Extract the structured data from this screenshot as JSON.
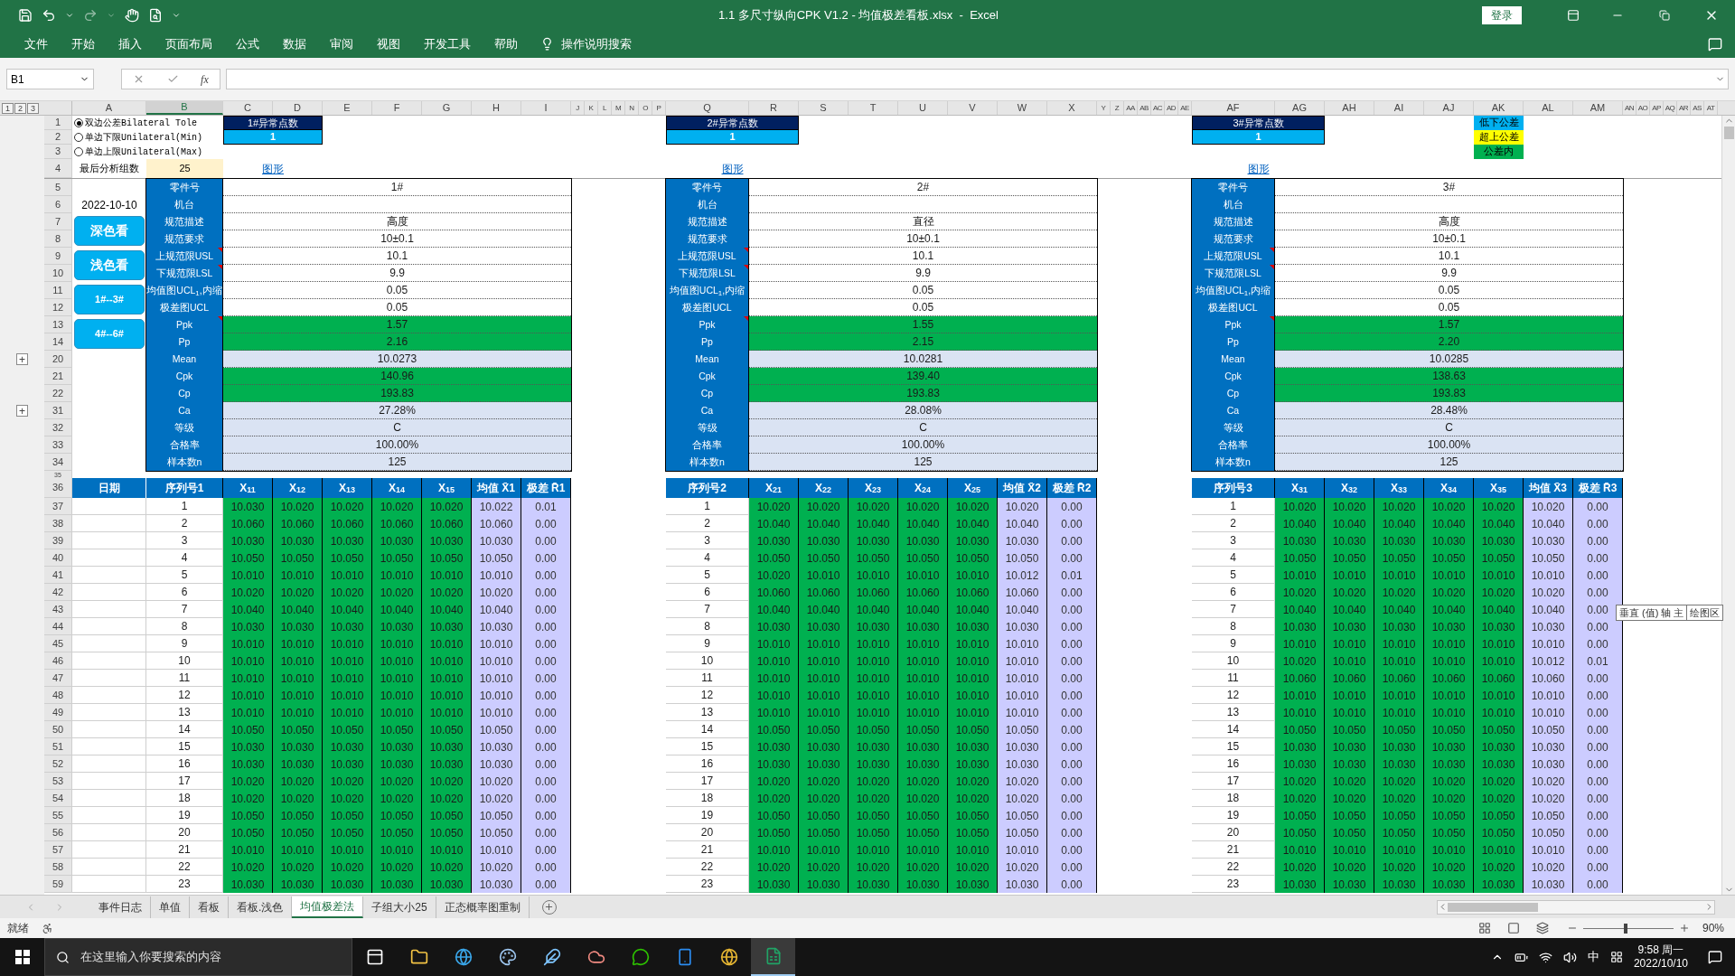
{
  "title_bar": {
    "title": "1.1 多尺寸纵向CPK V1.2 - 均值极差看板.xlsx  -  Excel",
    "sign_in": "登录"
  },
  "menu": [
    "文件",
    "开始",
    "插入",
    "页面布局",
    "公式",
    "数据",
    "审阅",
    "视图",
    "开发工具",
    "帮助"
  ],
  "tell_me": "操作说明搜索",
  "name_box": "B1",
  "fx": "fx",
  "outline_levels": [
    "1",
    "2",
    "3"
  ],
  "column_headers": [
    {
      "label": "A",
      "selected": false
    },
    {
      "label": "B",
      "selected": true
    },
    {
      "label": "C",
      "selected": false
    },
    {
      "label": "D",
      "selected": false
    },
    {
      "label": "E",
      "selected": false
    },
    {
      "label": "F",
      "selected": false
    },
    {
      "label": "G",
      "selected": false
    },
    {
      "label": "H",
      "selected": false
    },
    {
      "label": "I",
      "selected": false
    },
    {
      "label": "J",
      "selected": false
    },
    {
      "label": "K",
      "selected": false
    },
    {
      "label": "L",
      "selected": false
    },
    {
      "label": "M",
      "selected": false
    },
    {
      "label": "N",
      "selected": false
    },
    {
      "label": "O",
      "selected": false
    },
    {
      "label": "P",
      "selected": false
    },
    {
      "label": "Q",
      "selected": false
    },
    {
      "label": "R",
      "selected": false
    },
    {
      "label": "S",
      "selected": false
    },
    {
      "label": "T",
      "selected": false
    },
    {
      "label": "U",
      "selected": false
    },
    {
      "label": "V",
      "selected": false
    },
    {
      "label": "W",
      "selected": false
    },
    {
      "label": "X",
      "selected": false
    },
    {
      "label": "Y",
      "selected": false
    },
    {
      "label": "Z",
      "selected": false
    },
    {
      "label": "AA",
      "selected": false
    },
    {
      "label": "AB",
      "selected": false
    },
    {
      "label": "AC",
      "selected": false
    },
    {
      "label": "AD",
      "selected": false
    },
    {
      "label": "AE",
      "selected": false
    },
    {
      "label": "AF",
      "selected": false
    },
    {
      "label": "AG",
      "selected": false
    },
    {
      "label": "AH",
      "selected": false
    },
    {
      "label": "AI",
      "selected": false
    },
    {
      "label": "AJ",
      "selected": false
    },
    {
      "label": "AK",
      "selected": false
    },
    {
      "label": "AL",
      "selected": false
    },
    {
      "label": "AM",
      "selected": false
    },
    {
      "label": "AN",
      "selected": false
    },
    {
      "label": "AO",
      "selected": false
    },
    {
      "label": "AP",
      "selected": false
    },
    {
      "label": "AQ",
      "selected": false
    },
    {
      "label": "AR",
      "selected": false
    },
    {
      "label": "AS",
      "selected": false
    },
    {
      "label": "AT",
      "selected": false
    }
  ],
  "header_rows": [
    "1",
    "2",
    "3",
    "4"
  ],
  "options": [
    {
      "label": "双边公差Bilateral Tole",
      "selected": true
    },
    {
      "label": "单边下限Unilateral(Min)",
      "selected": false
    },
    {
      "label": "单边上限Unilateral(Max)",
      "selected": false
    }
  ],
  "group_count": {
    "label": "最后分析组数",
    "value": "25"
  },
  "legend": [
    {
      "label": "低下公差",
      "color": "#00b0f0"
    },
    {
      "label": "超上公差",
      "color": "#ffff00"
    },
    {
      "label": "公差内",
      "color": "#00b050"
    }
  ],
  "stat_rows": [
    {
      "label": "5"
    },
    {
      "label": "6"
    },
    {
      "label": "7"
    },
    {
      "label": "8"
    },
    {
      "label": "9"
    },
    {
      "label": "10"
    },
    {
      "label": "11"
    },
    {
      "label": "12"
    },
    {
      "label": "13"
    },
    {
      "label": "14"
    },
    {
      "label": "20",
      "expander": "+"
    },
    {
      "label": "21"
    },
    {
      "label": "22"
    },
    {
      "label": "31",
      "expander": "+"
    },
    {
      "label": "32"
    },
    {
      "label": "33"
    },
    {
      "label": "34"
    }
  ],
  "date": "2022-10-10",
  "view_buttons": [
    "深色看",
    "浅色看",
    "1#--3#",
    "4#--6#"
  ],
  "spacer_row": "35",
  "table_header_row": "36",
  "data_rows": [
    "37",
    "38",
    "39",
    "40",
    "41",
    "42",
    "43",
    "44",
    "45",
    "46",
    "47",
    "48",
    "49",
    "50",
    "51",
    "52",
    "53",
    "54",
    "55",
    "56",
    "57",
    "58",
    "59"
  ],
  "blocks": [
    {
      "abnormal": {
        "label": "1#异常点数",
        "value": "1"
      },
      "chart_link": "图形",
      "stats": [
        {
          "label": "零件号",
          "value": "1#",
          "kind": "input",
          "comment": false
        },
        {
          "label": "机台",
          "kind": "input",
          "comment": false
        },
        {
          "label": "规范描述",
          "value": "高度",
          "kind": "input",
          "comment": false
        },
        {
          "label": "规范要求",
          "value": "10±0.1",
          "kind": "input",
          "comment": false
        },
        {
          "label": "上规范限USL",
          "value": "10.1",
          "kind": "input",
          "comment": true
        },
        {
          "label": "下规范限LSL",
          "value": "9.9",
          "kind": "input",
          "comment": true
        },
        {
          "label": "均值图UCL$_{1}$,内缩",
          "value": "0.05",
          "kind": "input",
          "comment": false
        },
        {
          "label": "极差图UCL",
          "value": "0.05",
          "kind": "input",
          "comment": false
        },
        {
          "label": "Ppk",
          "value": "1.57",
          "kind": "pass",
          "comment": true
        },
        {
          "label": "Pp",
          "value": "2.16",
          "kind": "pass",
          "comment": false
        },
        {
          "label": "Mean",
          "value": "10.0273",
          "kind": "result",
          "comment": false
        },
        {
          "label": "Cpk",
          "value": "140.96",
          "kind": "pass",
          "comment": false
        },
        {
          "label": "Cp",
          "value": "193.83",
          "kind": "pass",
          "comment": false
        },
        {
          "label": "Ca",
          "value": "27.28%",
          "kind": "result",
          "comment": false
        },
        {
          "label": "等级",
          "value": "C",
          "kind": "result",
          "comment": false
        },
        {
          "label": "合格率",
          "value": "100.00%",
          "kind": "result",
          "comment": false
        },
        {
          "label": "样本数n",
          "value": "125",
          "kind": "result",
          "comment": false
        }
      ],
      "date_header": "日期",
      "columns": [
        {
          "label": "序列号1",
          "kind": "index"
        },
        {
          "label": "X$_{11}$",
          "kind": "measure"
        },
        {
          "label": "X$_{12}$",
          "kind": "measure"
        },
        {
          "label": "X$_{13}$",
          "kind": "measure"
        },
        {
          "label": "X$_{14}$",
          "kind": "measure"
        },
        {
          "label": "X$_{15}$",
          "kind": "measure"
        },
        {
          "label": "均值 X̄1",
          "kind": "summary"
        },
        {
          "label": "极差 R̄1",
          "kind": "summary"
        }
      ],
      "rows": [
        [
          "1",
          "10.030",
          "10.020",
          "10.020",
          "10.020",
          "10.020",
          "10.022",
          "0.01"
        ],
        [
          "2",
          "10.060",
          "10.060",
          "10.060",
          "10.060",
          "10.060",
          "10.060",
          "0.00"
        ],
        [
          "3",
          "10.030",
          "10.030",
          "10.030",
          "10.030",
          "10.030",
          "10.030",
          "0.00"
        ],
        [
          "4",
          "10.050",
          "10.050",
          "10.050",
          "10.050",
          "10.050",
          "10.050",
          "0.00"
        ],
        [
          "5",
          "10.010",
          "10.010",
          "10.010",
          "10.010",
          "10.010",
          "10.010",
          "0.00"
        ],
        [
          "6",
          "10.020",
          "10.020",
          "10.020",
          "10.020",
          "10.020",
          "10.020",
          "0.00"
        ],
        [
          "7",
          "10.040",
          "10.040",
          "10.040",
          "10.040",
          "10.040",
          "10.040",
          "0.00"
        ],
        [
          "8",
          "10.030",
          "10.030",
          "10.030",
          "10.030",
          "10.030",
          "10.030",
          "0.00"
        ],
        [
          "9",
          "10.010",
          "10.010",
          "10.010",
          "10.010",
          "10.010",
          "10.010",
          "0.00"
        ],
        [
          "10",
          "10.010",
          "10.010",
          "10.010",
          "10.010",
          "10.010",
          "10.010",
          "0.00"
        ],
        [
          "11",
          "10.010",
          "10.010",
          "10.010",
          "10.010",
          "10.010",
          "10.010",
          "0.00"
        ],
        [
          "12",
          "10.010",
          "10.010",
          "10.010",
          "10.010",
          "10.010",
          "10.010",
          "0.00"
        ],
        [
          "13",
          "10.010",
          "10.010",
          "10.010",
          "10.010",
          "10.010",
          "10.010",
          "0.00"
        ],
        [
          "14",
          "10.050",
          "10.050",
          "10.050",
          "10.050",
          "10.050",
          "10.050",
          "0.00"
        ],
        [
          "15",
          "10.030",
          "10.030",
          "10.030",
          "10.030",
          "10.030",
          "10.030",
          "0.00"
        ],
        [
          "16",
          "10.030",
          "10.030",
          "10.030",
          "10.030",
          "10.030",
          "10.030",
          "0.00"
        ],
        [
          "17",
          "10.020",
          "10.020",
          "10.020",
          "10.020",
          "10.020",
          "10.020",
          "0.00"
        ],
        [
          "18",
          "10.020",
          "10.020",
          "10.020",
          "10.020",
          "10.020",
          "10.020",
          "0.00"
        ],
        [
          "19",
          "10.050",
          "10.050",
          "10.050",
          "10.050",
          "10.050",
          "10.050",
          "0.00"
        ],
        [
          "20",
          "10.050",
          "10.050",
          "10.050",
          "10.050",
          "10.050",
          "10.050",
          "0.00"
        ],
        [
          "21",
          "10.010",
          "10.010",
          "10.010",
          "10.010",
          "10.010",
          "10.010",
          "0.00"
        ],
        [
          "22",
          "10.020",
          "10.020",
          "10.020",
          "10.020",
          "10.020",
          "10.020",
          "0.00"
        ],
        [
          "23",
          "10.030",
          "10.030",
          "10.030",
          "10.030",
          "10.030",
          "10.030",
          "0.00"
        ]
      ]
    },
    {
      "abnormal": {
        "label": "2#异常点数",
        "value": "1"
      },
      "chart_link": "图形",
      "stats": [
        {
          "label": "零件号",
          "value": "2#",
          "kind": "input",
          "comment": false
        },
        {
          "label": "机台",
          "kind": "input",
          "comment": false
        },
        {
          "label": "规范描述",
          "value": "直径",
          "kind": "input",
          "comment": false
        },
        {
          "label": "规范要求",
          "value": "10±0.1",
          "kind": "input",
          "comment": false
        },
        {
          "label": "上规范限USL",
          "value": "10.1",
          "kind": "input",
          "comment": true
        },
        {
          "label": "下规范限LSL",
          "value": "9.9",
          "kind": "input",
          "comment": true
        },
        {
          "label": "均值图UCL$_{1}$,内缩",
          "value": "0.05",
          "kind": "input",
          "comment": false
        },
        {
          "label": "极差图UCL",
          "value": "0.05",
          "kind": "input",
          "comment": false
        },
        {
          "label": "Ppk",
          "value": "1.55",
          "kind": "pass",
          "comment": true
        },
        {
          "label": "Pp",
          "value": "2.15",
          "kind": "pass",
          "comment": false
        },
        {
          "label": "Mean",
          "value": "10.0281",
          "kind": "result",
          "comment": false
        },
        {
          "label": "Cpk",
          "value": "139.40",
          "kind": "pass",
          "comment": false
        },
        {
          "label": "Cp",
          "value": "193.83",
          "kind": "pass",
          "comment": false
        },
        {
          "label": "Ca",
          "value": "28.08%",
          "kind": "result",
          "comment": false
        },
        {
          "label": "等级",
          "value": "C",
          "kind": "result",
          "comment": false
        },
        {
          "label": "合格率",
          "value": "100.00%",
          "kind": "result",
          "comment": false
        },
        {
          "label": "样本数n",
          "value": "125",
          "kind": "result",
          "comment": false
        }
      ],
      "columns": [
        {
          "label": "序列号2",
          "kind": "index"
        },
        {
          "label": "X$_{21}$",
          "kind": "measure"
        },
        {
          "label": "X$_{22}$",
          "kind": "measure"
        },
        {
          "label": "X$_{23}$",
          "kind": "measure"
        },
        {
          "label": "X$_{24}$",
          "kind": "measure"
        },
        {
          "label": "X$_{25}$",
          "kind": "measure"
        },
        {
          "label": "均值 X̄2",
          "kind": "summary"
        },
        {
          "label": "极差 R̄2",
          "kind": "summary"
        }
      ],
      "rows": [
        [
          "1",
          "10.020",
          "10.020",
          "10.020",
          "10.020",
          "10.020",
          "10.020",
          "0.00"
        ],
        [
          "2",
          "10.040",
          "10.040",
          "10.040",
          "10.040",
          "10.040",
          "10.040",
          "0.00"
        ],
        [
          "3",
          "10.030",
          "10.030",
          "10.030",
          "10.030",
          "10.030",
          "10.030",
          "0.00"
        ],
        [
          "4",
          "10.050",
          "10.050",
          "10.050",
          "10.050",
          "10.050",
          "10.050",
          "0.00"
        ],
        [
          "5",
          "10.020",
          "10.010",
          "10.010",
          "10.010",
          "10.010",
          "10.012",
          "0.01"
        ],
        [
          "6",
          "10.060",
          "10.060",
          "10.060",
          "10.060",
          "10.060",
          "10.060",
          "0.00"
        ],
        [
          "7",
          "10.040",
          "10.040",
          "10.040",
          "10.040",
          "10.040",
          "10.040",
          "0.00"
        ],
        [
          "8",
          "10.030",
          "10.030",
          "10.030",
          "10.030",
          "10.030",
          "10.030",
          "0.00"
        ],
        [
          "9",
          "10.010",
          "10.010",
          "10.010",
          "10.010",
          "10.010",
          "10.010",
          "0.00"
        ],
        [
          "10",
          "10.010",
          "10.010",
          "10.010",
          "10.010",
          "10.010",
          "10.010",
          "0.00"
        ],
        [
          "11",
          "10.010",
          "10.010",
          "10.010",
          "10.010",
          "10.010",
          "10.010",
          "0.00"
        ],
        [
          "12",
          "10.010",
          "10.010",
          "10.010",
          "10.010",
          "10.010",
          "10.010",
          "0.00"
        ],
        [
          "13",
          "10.010",
          "10.010",
          "10.010",
          "10.010",
          "10.010",
          "10.010",
          "0.00"
        ],
        [
          "14",
          "10.050",
          "10.050",
          "10.050",
          "10.050",
          "10.050",
          "10.050",
          "0.00"
        ],
        [
          "15",
          "10.030",
          "10.030",
          "10.030",
          "10.030",
          "10.030",
          "10.030",
          "0.00"
        ],
        [
          "16",
          "10.030",
          "10.030",
          "10.030",
          "10.030",
          "10.030",
          "10.030",
          "0.00"
        ],
        [
          "17",
          "10.020",
          "10.020",
          "10.020",
          "10.020",
          "10.020",
          "10.020",
          "0.00"
        ],
        [
          "18",
          "10.020",
          "10.020",
          "10.020",
          "10.020",
          "10.020",
          "10.020",
          "0.00"
        ],
        [
          "19",
          "10.050",
          "10.050",
          "10.050",
          "10.050",
          "10.050",
          "10.050",
          "0.00"
        ],
        [
          "20",
          "10.050",
          "10.050",
          "10.050",
          "10.050",
          "10.050",
          "10.050",
          "0.00"
        ],
        [
          "21",
          "10.010",
          "10.010",
          "10.010",
          "10.010",
          "10.010",
          "10.010",
          "0.00"
        ],
        [
          "22",
          "10.020",
          "10.020",
          "10.020",
          "10.020",
          "10.020",
          "10.020",
          "0.00"
        ],
        [
          "23",
          "10.030",
          "10.030",
          "10.030",
          "10.030",
          "10.030",
          "10.030",
          "0.00"
        ]
      ]
    },
    {
      "abnormal": {
        "label": "3#异常点数",
        "value": "1"
      },
      "chart_link": "图形",
      "stats": [
        {
          "label": "零件号",
          "value": "3#",
          "kind": "input",
          "comment": false
        },
        {
          "label": "机台",
          "kind": "input",
          "comment": false
        },
        {
          "label": "规范描述",
          "value": "高度",
          "kind": "input",
          "comment": false
        },
        {
          "label": "规范要求",
          "value": "10±0.1",
          "kind": "input",
          "comment": false
        },
        {
          "label": "上规范限USL",
          "value": "10.1",
          "kind": "input",
          "comment": true
        },
        {
          "label": "下规范限LSL",
          "value": "9.9",
          "kind": "input",
          "comment": true
        },
        {
          "label": "均值图UCL$_{1}$,内缩",
          "value": "0.05",
          "kind": "input",
          "comment": false
        },
        {
          "label": "极差图UCL",
          "value": "0.05",
          "kind": "input",
          "comment": false
        },
        {
          "label": "Ppk",
          "value": "1.57",
          "kind": "pass",
          "comment": true
        },
        {
          "label": "Pp",
          "value": "2.20",
          "kind": "pass",
          "comment": false
        },
        {
          "label": "Mean",
          "value": "10.0285",
          "kind": "result",
          "comment": false
        },
        {
          "label": "Cpk",
          "value": "138.63",
          "kind": "pass",
          "comment": false
        },
        {
          "label": "Cp",
          "value": "193.83",
          "kind": "pass",
          "comment": false
        },
        {
          "label": "Ca",
          "value": "28.48%",
          "kind": "result",
          "comment": false
        },
        {
          "label": "等级",
          "value": "C",
          "kind": "result",
          "comment": false
        },
        {
          "label": "合格率",
          "value": "100.00%",
          "kind": "result",
          "comment": false
        },
        {
          "label": "样本数n",
          "value": "125",
          "kind": "result",
          "comment": false
        }
      ],
      "columns": [
        {
          "label": "序列号3",
          "kind": "index"
        },
        {
          "label": "X$_{31}$",
          "kind": "measure"
        },
        {
          "label": "X$_{32}$",
          "kind": "measure"
        },
        {
          "label": "X$_{33}$",
          "kind": "measure"
        },
        {
          "label": "X$_{34}$",
          "kind": "measure"
        },
        {
          "label": "X$_{35}$",
          "kind": "measure"
        },
        {
          "label": "均值 X̄3",
          "kind": "summary"
        },
        {
          "label": "极差 R̄3",
          "kind": "summary"
        }
      ],
      "rows": [
        [
          "1",
          "10.020",
          "10.020",
          "10.020",
          "10.020",
          "10.020",
          "10.020",
          "0.00"
        ],
        [
          "2",
          "10.040",
          "10.040",
          "10.040",
          "10.040",
          "10.040",
          "10.040",
          "0.00"
        ],
        [
          "3",
          "10.030",
          "10.030",
          "10.030",
          "10.030",
          "10.030",
          "10.030",
          "0.00"
        ],
        [
          "4",
          "10.050",
          "10.050",
          "10.050",
          "10.050",
          "10.050",
          "10.050",
          "0.00"
        ],
        [
          "5",
          "10.010",
          "10.010",
          "10.010",
          "10.010",
          "10.010",
          "10.010",
          "0.00"
        ],
        [
          "6",
          "10.020",
          "10.020",
          "10.020",
          "10.020",
          "10.020",
          "10.020",
          "0.00"
        ],
        [
          "7",
          "10.040",
          "10.040",
          "10.040",
          "10.040",
          "10.040",
          "10.040",
          "0.00"
        ],
        [
          "8",
          "10.030",
          "10.030",
          "10.030",
          "10.030",
          "10.030",
          "10.030",
          "0.00"
        ],
        [
          "9",
          "10.010",
          "10.010",
          "10.010",
          "10.010",
          "10.010",
          "10.010",
          "0.00"
        ],
        [
          "10",
          "10.020",
          "10.010",
          "10.010",
          "10.010",
          "10.010",
          "10.012",
          "0.01"
        ],
        [
          "11",
          "10.060",
          "10.060",
          "10.060",
          "10.060",
          "10.060",
          "10.060",
          "0.00"
        ],
        [
          "12",
          "10.010",
          "10.010",
          "10.010",
          "10.010",
          "10.010",
          "10.010",
          "0.00"
        ],
        [
          "13",
          "10.010",
          "10.010",
          "10.010",
          "10.010",
          "10.010",
          "10.010",
          "0.00"
        ],
        [
          "14",
          "10.050",
          "10.050",
          "10.050",
          "10.050",
          "10.050",
          "10.050",
          "0.00"
        ],
        [
          "15",
          "10.030",
          "10.030",
          "10.030",
          "10.030",
          "10.030",
          "10.030",
          "0.00"
        ],
        [
          "16",
          "10.030",
          "10.030",
          "10.030",
          "10.030",
          "10.030",
          "10.030",
          "0.00"
        ],
        [
          "17",
          "10.020",
          "10.020",
          "10.020",
          "10.020",
          "10.020",
          "10.020",
          "0.00"
        ],
        [
          "18",
          "10.020",
          "10.020",
          "10.020",
          "10.020",
          "10.020",
          "10.020",
          "0.00"
        ],
        [
          "19",
          "10.050",
          "10.050",
          "10.050",
          "10.050",
          "10.050",
          "10.050",
          "0.00"
        ],
        [
          "20",
          "10.050",
          "10.050",
          "10.050",
          "10.050",
          "10.050",
          "10.050",
          "0.00"
        ],
        [
          "21",
          "10.010",
          "10.010",
          "10.010",
          "10.010",
          "10.010",
          "10.010",
          "0.00"
        ],
        [
          "22",
          "10.020",
          "10.020",
          "10.020",
          "10.020",
          "10.020",
          "10.020",
          "0.00"
        ],
        [
          "23",
          "10.030",
          "10.030",
          "10.030",
          "10.030",
          "10.030",
          "10.030",
          "0.00"
        ]
      ]
    }
  ],
  "tooltips": [
    "垂直 (值) 轴 主",
    "绘图区"
  ],
  "sheet_tabs": [
    {
      "label": "事件日志",
      "selected": false
    },
    {
      "label": "单值",
      "selected": false
    },
    {
      "label": "看板",
      "selected": false
    },
    {
      "label": "看板.浅色",
      "selected": false
    },
    {
      "label": "均值极差法",
      "selected": true
    },
    {
      "label": "子组大小25",
      "selected": false
    },
    {
      "label": "正态概率图重制",
      "selected": false
    }
  ],
  "status_bar": {
    "ready": "就绪",
    "zoom": {
      "level": 0.47,
      "reading": "90%"
    }
  },
  "taskbar": {
    "search_placeholder": "在这里输入你要搜索的内容",
    "ime": "中",
    "time": "9:58 周一",
    "date": "2022/10/10"
  }
}
